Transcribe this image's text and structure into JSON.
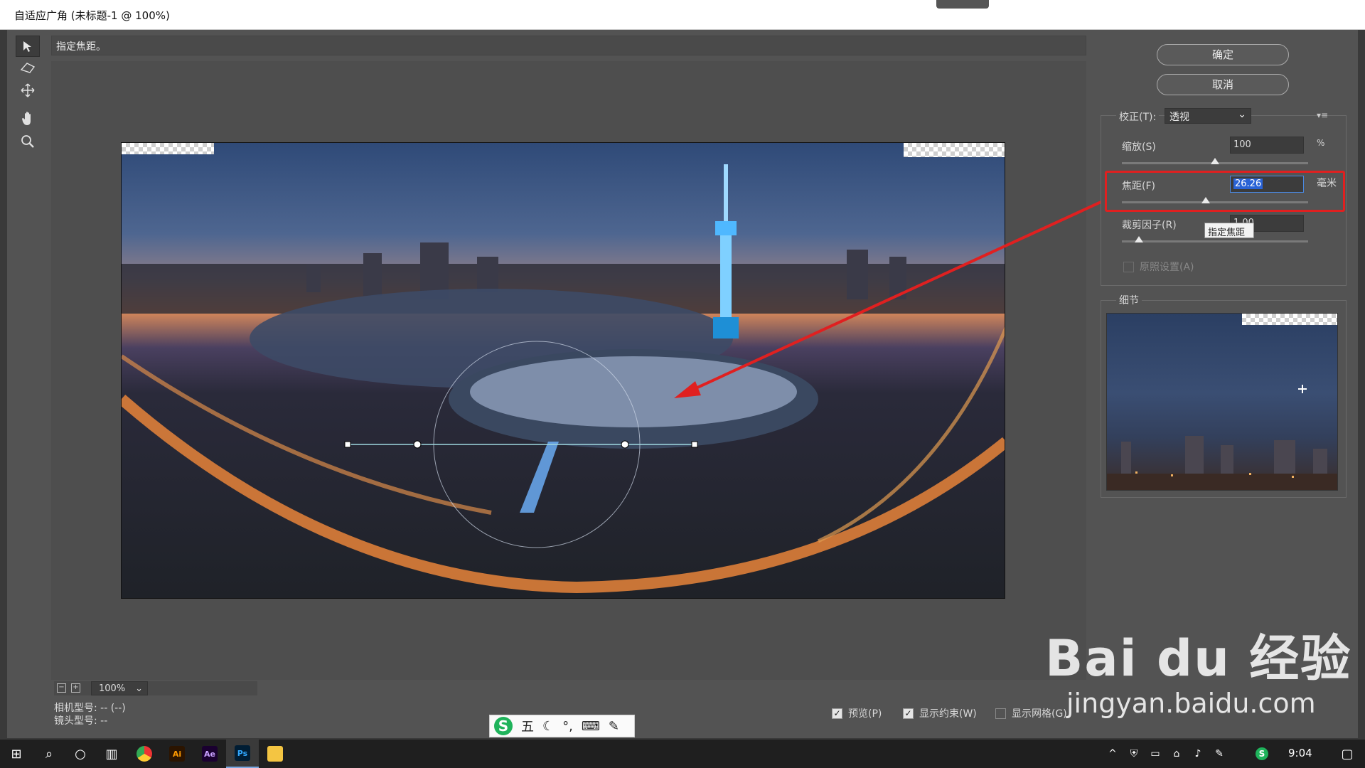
{
  "window": {
    "title": "自适应广角 (未标题-1 @ 100%)"
  },
  "hint": {
    "text": "指定焦距。"
  },
  "tools": [
    "constraint-tool",
    "polygon-constraint-tool",
    "move-tool",
    "hand-tool",
    "zoom-tool"
  ],
  "buttons": {
    "ok": "确定",
    "cancel": "取消"
  },
  "correction": {
    "label": "校正(T):",
    "value": "透视"
  },
  "params": {
    "scale": {
      "label": "缩放(S)",
      "value": "100",
      "unit": "%",
      "slider_fraction": 0.5
    },
    "focal": {
      "label": "焦距(F)",
      "value": "26.26",
      "unit": "毫米",
      "slider_fraction": 0.45
    },
    "crop": {
      "label": "裁剪因子(R)",
      "value": "1.00",
      "slider_fraction": 0.09
    }
  },
  "tooltip": "指定焦距",
  "original_setting": "原照设置(A)",
  "detail_label": "细节",
  "zoom": {
    "value": "100%"
  },
  "camera_model": "相机型号: -- (--)",
  "lens_model": "镜头型号: --",
  "options": {
    "preview": "预览(P)",
    "show_constraints": "显示约束(W)",
    "show_grid": "显示网格(G)"
  },
  "ime": {
    "mode": "五"
  },
  "taskbar": {
    "apps": [
      "Ai",
      "Ae",
      "Ps"
    ],
    "time": "9:04"
  },
  "watermark": {
    "line1": "Bai du 经验",
    "line2": "jingyan.baidu.com"
  },
  "colors": {
    "highlight_red": "#e02020",
    "panel": "#535353",
    "field": "#3c3c3c"
  }
}
